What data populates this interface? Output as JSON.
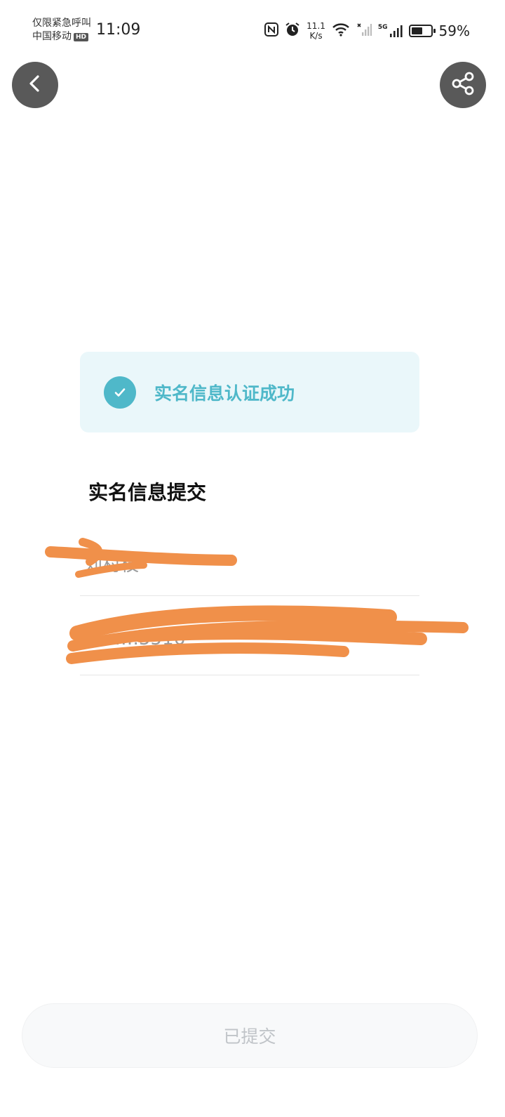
{
  "status_bar": {
    "emergency_text": "仅限紧急呼叫",
    "carrier": "中国移动",
    "hd_badge": "HD",
    "time": "11:09",
    "net_speed_value": "11.1",
    "net_speed_unit": "K/s",
    "signal_label": "5G",
    "battery_percent": "59%",
    "battery_level": 0.59
  },
  "header": {
    "back_icon": "chevron-left-icon",
    "share_icon": "share-icon"
  },
  "banner": {
    "status_text": "实名信息认证成功",
    "accent_color": "#4fb8c9"
  },
  "section": {
    "title": "实名信息提交",
    "name_value": "刘村枝",
    "id_value": "………5516"
  },
  "footer": {
    "submit_label": "已提交"
  },
  "colors": {
    "redaction": "#f0904a",
    "button_bg": "#595959"
  }
}
